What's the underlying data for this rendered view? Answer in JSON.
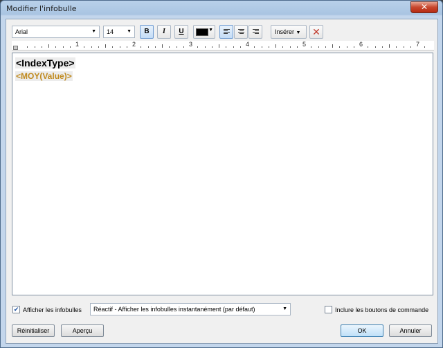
{
  "window": {
    "title": "Modifier l'infobulle",
    "close_glyph": "✕"
  },
  "toolbar": {
    "font_family": "Arial",
    "font_size": "14",
    "bold_label": "B",
    "italic_label": "I",
    "underline_label": "U",
    "text_color": "#000000",
    "insert_label": "Insérer",
    "clear_glyph": "✕",
    "align_selected": "left"
  },
  "ruler": {
    "numbers": [
      "1",
      "2",
      "3",
      "4",
      "5",
      "6",
      "7"
    ]
  },
  "editor": {
    "line1": "<IndexType>",
    "line2": "<MOY(Value)>",
    "line2_color": "#c08a1e"
  },
  "options": {
    "show_tooltips_label": "Afficher les infobulles",
    "show_tooltips_checked": true,
    "tooltip_mode": "Réactif - Afficher les infobulles instantanément (par défaut)",
    "include_buttons_label": "Inclure les boutons de commande",
    "include_buttons_checked": false
  },
  "buttons": {
    "reset": "Réinitialiser",
    "preview": "Aperçu",
    "ok": "OK",
    "cancel": "Annuler"
  }
}
